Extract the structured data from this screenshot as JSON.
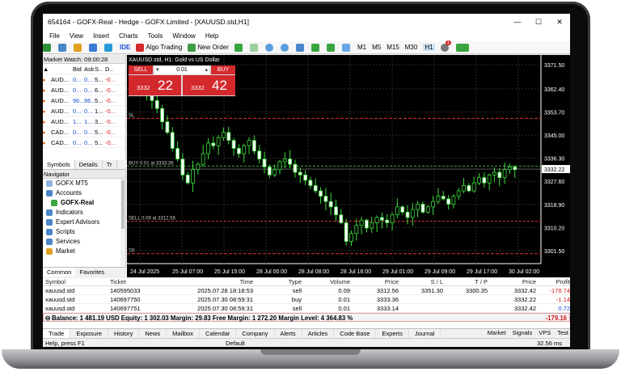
{
  "window": {
    "title": "654164 - GOFX-Real - Hedge - GOFX Limited - [XAUUSD.std,H1]",
    "min": "—",
    "max": "☐",
    "close": "✕"
  },
  "menu": [
    "File",
    "View",
    "Insert",
    "Charts",
    "Tools",
    "Window",
    "Help"
  ],
  "toolbar": {
    "ide": "IDE",
    "algo": "Algo Trading",
    "new_order": "New Order",
    "timeframes": [
      "M1",
      "M5",
      "M15",
      "M30",
      "H1"
    ],
    "active_timeframe": "H1",
    "notif_count": "1"
  },
  "market_watch": {
    "title": "Market Watch: 09:00:28",
    "headers": [
      "▲",
      "Bid",
      "Ask",
      "S..",
      "D.."
    ],
    "rows": [
      {
        "sym": "AUD...",
        "bid": "0...",
        "ask": "0...",
        "s": "5...",
        "d": "-0..."
      },
      {
        "sym": "AUD...",
        "bid": "0...",
        "ask": "0...",
        "s": "6...",
        "d": "-0..."
      },
      {
        "sym": "AUD...",
        "bid": "96...",
        "ask": "96...",
        "s": "5...",
        "d": "-0..."
      },
      {
        "sym": "AUD...",
        "bid": "0...",
        "ask": "0...",
        "s": "1...",
        "d": "-0..."
      },
      {
        "sym": "AUD...",
        "bid": "1...",
        "ask": "1...",
        "s": "3...",
        "d": "-0..."
      },
      {
        "sym": "CAD...",
        "bid": "0...",
        "ask": "0...",
        "s": "5...",
        "d": "-0..."
      },
      {
        "sym": "CAD...",
        "bid": "0...",
        "ask": "0...",
        "s": "5...",
        "d": "-0..."
      }
    ],
    "tabs": [
      "Symbols",
      "Details",
      "Tr"
    ]
  },
  "navigator": {
    "title": "Navigator",
    "items": [
      "GOFX MT5",
      "Accounts",
      "GOFX-Real",
      "Indicators",
      "Expert Advisors",
      "Scripts",
      "Services",
      "Market"
    ],
    "tabs": [
      "Common",
      "Favorites"
    ]
  },
  "chart": {
    "symbol_label": "XAUUSD.std, H1:  Gold vs US Dollar",
    "sell_label": "SELL",
    "buy_label": "BUY",
    "lot": "0.01",
    "bid_small": "3332",
    "bid_big": "22",
    "ask_small": "3332",
    "ask_big": "42",
    "price_ticks": [
      "3371.50",
      "3362.40",
      "3353.70",
      "3345.00",
      "3336.30",
      "3327.60",
      "3318.90",
      "3310.20",
      "3301.50"
    ],
    "current_price": "3332.22",
    "time_ticks": [
      "24 Jul 2025",
      "25 Jul 07:00",
      "25 Jul 15:00",
      "28 Jul 00:00",
      "28 Jul 08:00",
      "28 Jul 16:00",
      "29 Jul 01:00",
      "29 Jul 09:00",
      "29 Jul 17:00",
      "30 Jul 02:00"
    ],
    "lines": {
      "sl": "SL",
      "buy_line": "BUY 0.01 at 3333.36",
      "sell_line": "SELL 0.09 at 3312.56",
      "tp": "TP"
    }
  },
  "trades": {
    "headers": [
      "Symbol",
      "Ticket",
      "Time",
      "Type",
      "Volume",
      "Price",
      "S / L",
      "T / P",
      "Price",
      "Profit"
    ],
    "rows": [
      {
        "symbol": "xauusd.std",
        "ticket": "140595033",
        "time": "2025.07.28 18:18:53",
        "type": "sell",
        "volume": "0.09",
        "price": "3312.56",
        "sl": "3351.30",
        "tp": "3300.35",
        "cur": "3332.42",
        "profit": "-178.74"
      },
      {
        "symbol": "xauusd.std",
        "ticket": "140697750",
        "time": "2025.07.30 08:59:31",
        "type": "buy",
        "volume": "0.01",
        "price": "3333.36",
        "sl": "",
        "tp": "",
        "cur": "3332.22",
        "profit": "-1.14"
      },
      {
        "symbol": "xauusd.std",
        "ticket": "140697751",
        "time": "2025.07.30 08:59:31",
        "type": "sell",
        "volume": "0.01",
        "price": "3333.14",
        "sl": "",
        "tp": "",
        "cur": "3332.42",
        "profit": "0.72"
      }
    ],
    "balance_line": "Balance: 1 481.19 USD  Equity: 1 302.03  Margin: 29.83  Free Margin: 1 272.20  Margin Level: 4 364.83 %",
    "total_profit": "-179.16"
  },
  "bottom_tabs": [
    "Trade",
    "Exposure",
    "History",
    "News",
    "Mailbox",
    "Calendar",
    "Company",
    "Alerts",
    "Articles",
    "Code Base",
    "Experts",
    "Journal"
  ],
  "bottom_right": [
    "Market",
    "Signals",
    "VPS",
    "Test"
  ],
  "status": {
    "help": "Help, press F1",
    "profile": "Default",
    "ping": "32.56 ms"
  }
}
